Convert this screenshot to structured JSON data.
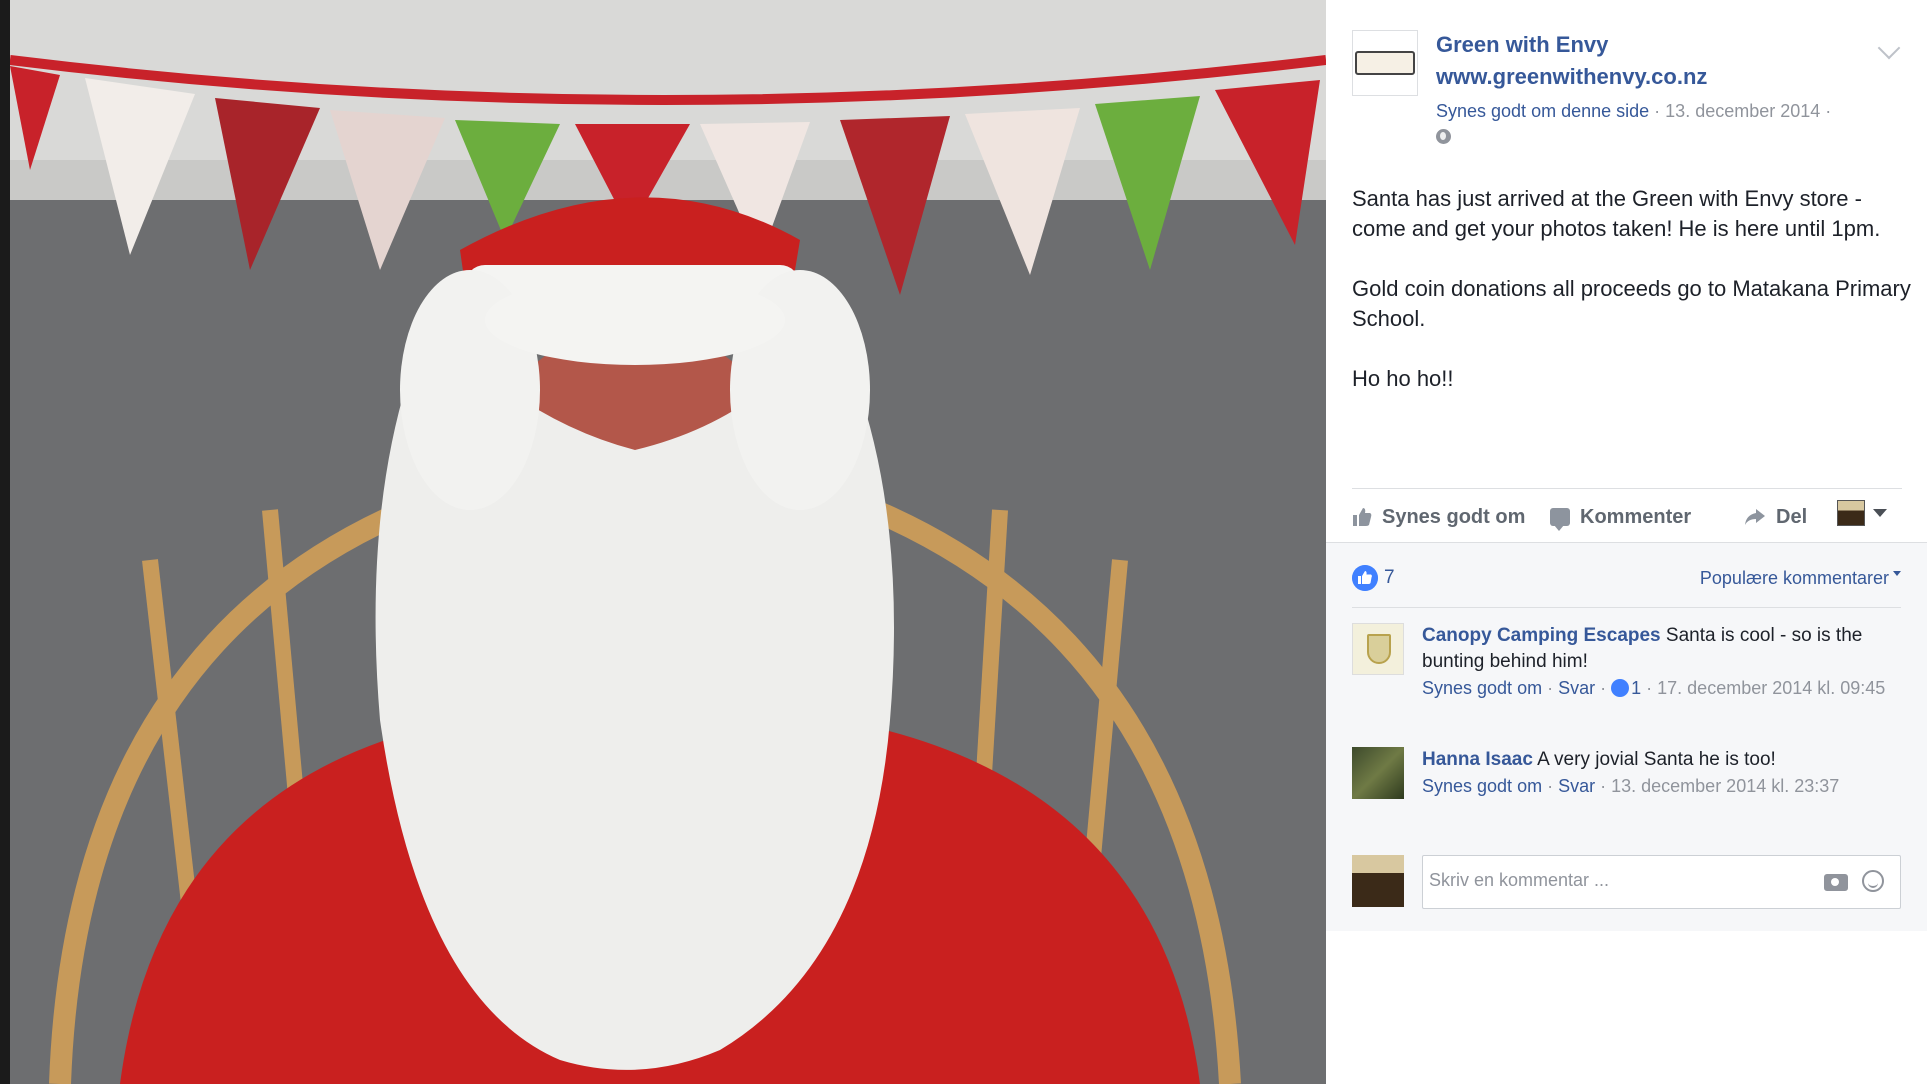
{
  "post": {
    "page_name": "Green with Envy",
    "page_url": "www.greenwithenvy.co.nz",
    "like_page_label": "Synes godt om denne side",
    "date": "· 13. december 2014 ·",
    "text_paragraphs": [
      "Santa has just arrived at the Green with Envy store - come and get your photos taken! He is here until 1pm.",
      "Gold coin donations all proceeds go to Matakana Primary School.",
      "Ho ho ho!!"
    ]
  },
  "actions": {
    "like_label": "Synes godt om",
    "comment_label": "Kommenter",
    "share_label": "Del"
  },
  "reactions": {
    "count": "7",
    "sort_label": "Populære kommentarer"
  },
  "comments": [
    {
      "author": "Canopy Camping Escapes",
      "text": "Santa is cool - so is the bunting behind him!",
      "like_label": "Synes godt om",
      "reply_label": "Svar",
      "like_count": "1",
      "timestamp": "· 17. december 2014 kl. 09:45"
    },
    {
      "author": "Hanna Isaac",
      "text": "A very jovial Santa he is too!",
      "like_label": "Synes godt om",
      "reply_label": "Svar",
      "timestamp": "· 13. december 2014 kl. 23:37"
    }
  ],
  "compose": {
    "placeholder": "Skriv en kommentar ..."
  },
  "colors": {
    "link": "#365899",
    "meta": "#90949c",
    "like_blue": "#4080ff",
    "bunting_red": "#c8222a",
    "bunting_green": "#6cae3e"
  }
}
